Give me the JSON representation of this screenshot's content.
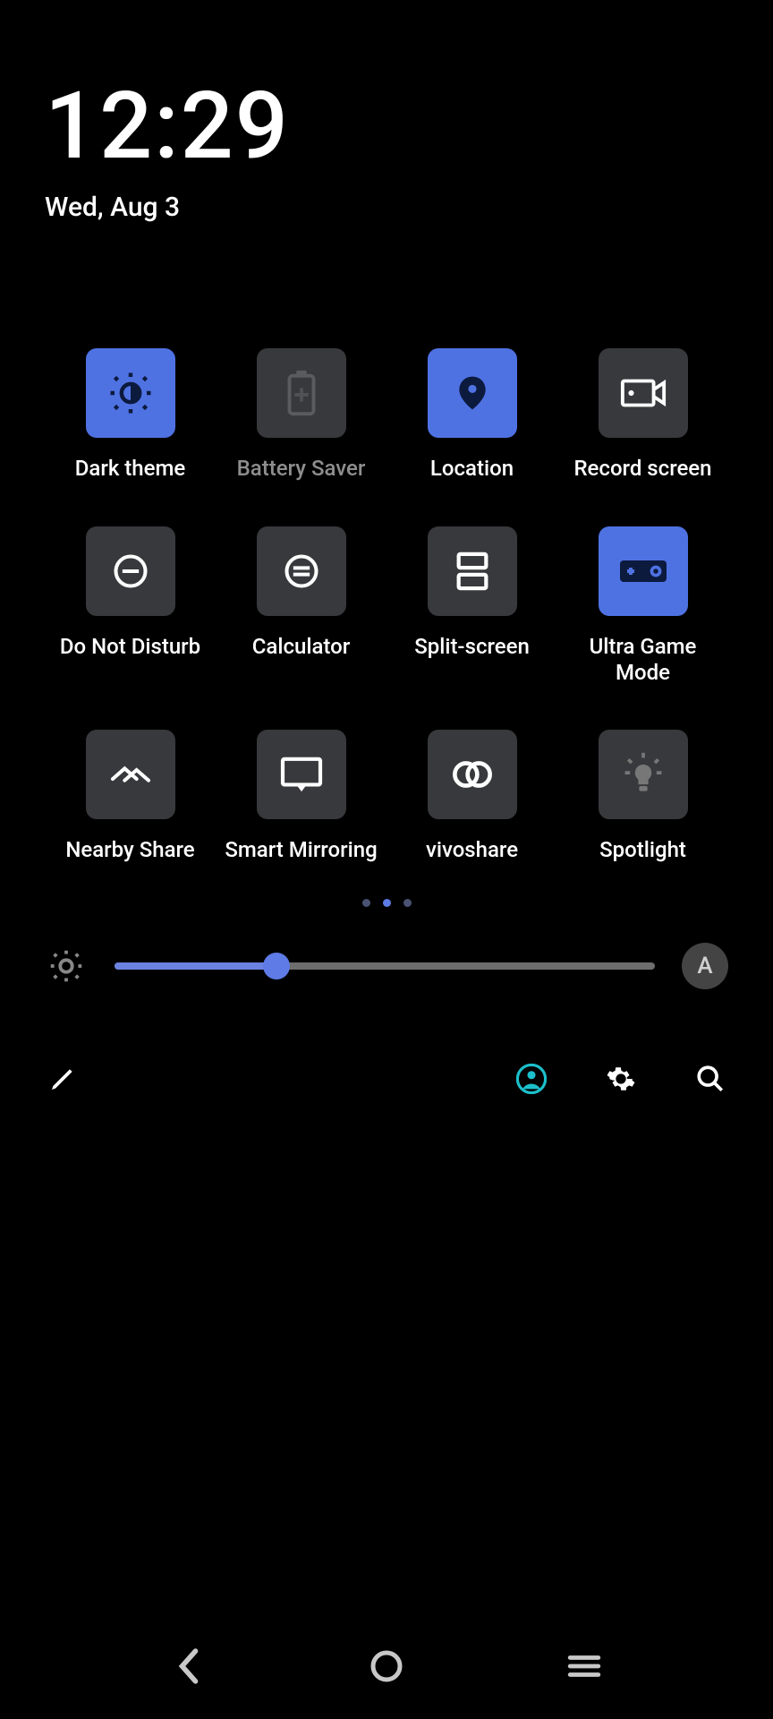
{
  "time": "12:29",
  "date": "Wed, Aug 3",
  "tiles": [
    {
      "id": "dark-theme",
      "label": "Dark theme",
      "active": true,
      "muted": false,
      "icon": "sun-dark"
    },
    {
      "id": "battery-saver",
      "label": "Battery Saver",
      "active": false,
      "muted": true,
      "icon": "battery"
    },
    {
      "id": "location",
      "label": "Location",
      "active": true,
      "muted": false,
      "icon": "location"
    },
    {
      "id": "record-screen",
      "label": "Record screen",
      "active": false,
      "muted": false,
      "icon": "camcorder"
    },
    {
      "id": "dnd",
      "label": "Do Not Disturb",
      "active": false,
      "muted": false,
      "icon": "aaadnd"
    },
    {
      "id": "calculator",
      "label": "Calculator",
      "active": false,
      "muted": false,
      "icon": "calc"
    },
    {
      "id": "split-screen",
      "label": "Split-screen",
      "active": false,
      "muted": false,
      "icon": "split"
    },
    {
      "id": "ultra-game",
      "label": "Ultra Game Mode",
      "active": true,
      "muted": false,
      "icon": "game"
    },
    {
      "id": "nearby-share",
      "label": "Nearby Share",
      "active": false,
      "muted": false,
      "icon": "nearby"
    },
    {
      "id": "smart-mirror",
      "label": "Smart Mirroring",
      "active": false,
      "muted": false,
      "icon": "cast"
    },
    {
      "id": "vivoshare",
      "label": "vivoshare",
      "active": false,
      "muted": false,
      "icon": "vivoshare"
    },
    {
      "id": "spotlight",
      "label": "Spotlight",
      "active": false,
      "muted": false,
      "icon": "bulb"
    }
  ],
  "page_indicator": {
    "count": 3,
    "active": 1
  },
  "brightness": {
    "percent": 30,
    "auto_label": "A"
  },
  "colors": {
    "accent": "#4f72e3",
    "tile_bg": "#38393c",
    "muted_text": "#8e8e8e"
  }
}
